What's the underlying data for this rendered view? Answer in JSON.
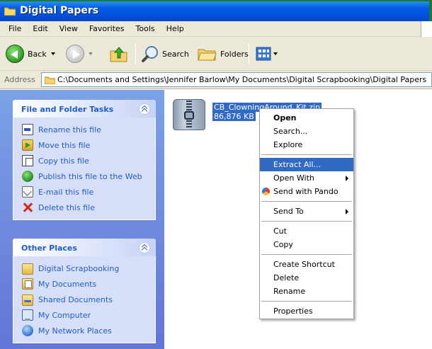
{
  "window": {
    "title": "Digital Papers"
  },
  "menubar": [
    "File",
    "Edit",
    "View",
    "Favorites",
    "Tools",
    "Help"
  ],
  "toolbar": {
    "back_label": "Back",
    "search_label": "Search",
    "folders_label": "Folders"
  },
  "address": {
    "label": "Address",
    "value": "C:\\Documents and Settings\\Jennifer Barlow\\My Documents\\Digital Scrapbooking\\Digital Papers"
  },
  "file_folder_tasks": {
    "title": "File and Folder Tasks",
    "items": [
      {
        "label": "Rename this file",
        "icon": "rename-icon"
      },
      {
        "label": "Move this file",
        "icon": "move-icon"
      },
      {
        "label": "Copy this file",
        "icon": "copy-icon"
      },
      {
        "label": "Publish this file to the Web",
        "icon": "publish-icon"
      },
      {
        "label": "E-mail this file",
        "icon": "email-icon"
      },
      {
        "label": "Delete this file",
        "icon": "delete-icon"
      }
    ]
  },
  "other_places": {
    "title": "Other Places",
    "items": [
      {
        "label": "Digital Scrapbooking",
        "icon": "folder-icon"
      },
      {
        "label": "My Documents",
        "icon": "my-documents-icon"
      },
      {
        "label": "Shared Documents",
        "icon": "shared-folder-icon"
      },
      {
        "label": "My Computer",
        "icon": "computer-icon"
      },
      {
        "label": "My Network Places",
        "icon": "network-icon"
      }
    ]
  },
  "file": {
    "name": "CB_ClowningAround_Kit.zip",
    "size": "86,876 KB"
  },
  "context_menu": {
    "items": [
      {
        "label": "Open",
        "bold": true
      },
      {
        "label": "Search..."
      },
      {
        "label": "Explore"
      },
      {
        "separator": true
      },
      {
        "label": "Extract All...",
        "highlighted": true
      },
      {
        "label": "Open With",
        "submenu": true
      },
      {
        "label": "Send with Pando",
        "icon": "pando-icon"
      },
      {
        "separator": true
      },
      {
        "label": "Send To",
        "submenu": true
      },
      {
        "separator": true
      },
      {
        "label": "Cut"
      },
      {
        "label": "Copy"
      },
      {
        "separator": true
      },
      {
        "label": "Create Shortcut"
      },
      {
        "label": "Delete"
      },
      {
        "label": "Rename"
      },
      {
        "separator": true
      },
      {
        "label": "Properties"
      }
    ]
  },
  "colors": {
    "titlebar": "#0054e3",
    "highlight": "#316ac5",
    "task_link": "#215dc6",
    "panel": "#7ba2e7"
  }
}
